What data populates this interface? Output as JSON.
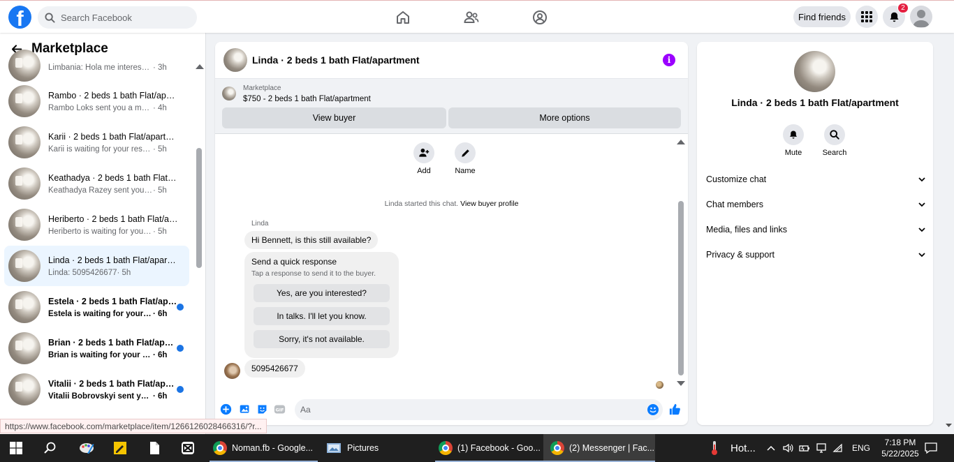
{
  "topbar": {
    "search_placeholder": "Search Facebook",
    "find_friends": "Find friends",
    "notifications_count": "2"
  },
  "sidebar": {
    "title": "Marketplace",
    "conversations": [
      {
        "title": "",
        "preview": "Limbania: Hola me interesa pu...",
        "time": " · 3h",
        "unread": false
      },
      {
        "title": "Rambo · 2 beds 1 bath Flat/apart...",
        "preview": "Rambo Loks sent you a messag...",
        "time": " · 4h",
        "unread": false
      },
      {
        "title": "Karii · 2 beds 1 bath Flat/apartment",
        "preview": "Karii is waiting for your respo...",
        "time": " · 5h",
        "unread": false
      },
      {
        "title": "Keathadya · 2 beds 1 bath Flat/ap...",
        "preview": "Keathadya Razey sent you a me...",
        "time": " · 5h",
        "unread": false
      },
      {
        "title": "Heriberto · 2 beds 1 bath Flat/apa...",
        "preview": "Heriberto is waiting for your r...",
        "time": " · 5h",
        "unread": false
      },
      {
        "title": "Linda · 2 beds 1 bath Flat/apartm...",
        "preview": "Linda: 5095426677",
        "time": " · 5h",
        "unread": false
      },
      {
        "title": "Estela · 2 beds 1 bath Flat/apart...",
        "preview": "Estela is waiting for your res...",
        "time": " · 6h",
        "unread": true
      },
      {
        "title": "Brian · 2 beds 1 bath Flat/apart...",
        "preview": "Brian is waiting for your resp...",
        "time": " · 6h",
        "unread": true
      },
      {
        "title": "Vitalii · 2 beds 1 bath Flat/apart...",
        "preview": "Vitalii Bobrovskyi sent you a ...",
        "time": " · 6h",
        "unread": true
      }
    ]
  },
  "chat": {
    "title": "Linda · 2 beds 1 bath Flat/apartment",
    "listing_label": "Marketplace",
    "listing_price_title": "$750 - 2 beds 1 bath Flat/apartment",
    "view_buyer": "View buyer",
    "more_options": "More options",
    "add_label": "Add",
    "name_label": "Name",
    "started_text": "Linda started this chat.",
    "view_profile": "View buyer profile",
    "sender": "Linda",
    "message1": "Hi Bennett, is this still available?",
    "quick_title": "Send a quick response",
    "quick_sub": "Tap a response to send it to the buyer.",
    "quick_replies": [
      "Yes, are you interested?",
      "In talks. I'll let you know.",
      "Sorry, it's not available."
    ],
    "message2": "5095426677",
    "composer_placeholder": "Aa"
  },
  "details": {
    "title": "Linda · 2 beds 1 bath Flat/apartment",
    "mute": "Mute",
    "search": "Search",
    "sections": [
      "Customize chat",
      "Chat members",
      "Media, files and links",
      "Privacy & support"
    ]
  },
  "status_url": "https://www.facebook.com/marketplace/item/1266126028466316/?r...",
  "taskbar": {
    "items": [
      "Noman.fb - Google...",
      "Pictures",
      "(1) Facebook - Goo...",
      "(2) Messenger | Fac..."
    ],
    "weather": "Hot...",
    "lang": "ENG",
    "time": "7:18 PM",
    "date": "5/22/2025"
  },
  "colors": {
    "brand": "#1877f2",
    "accent_purple": "#9b00ff",
    "unread_dot": "#1b74e4",
    "badge": "#e41e3f"
  }
}
